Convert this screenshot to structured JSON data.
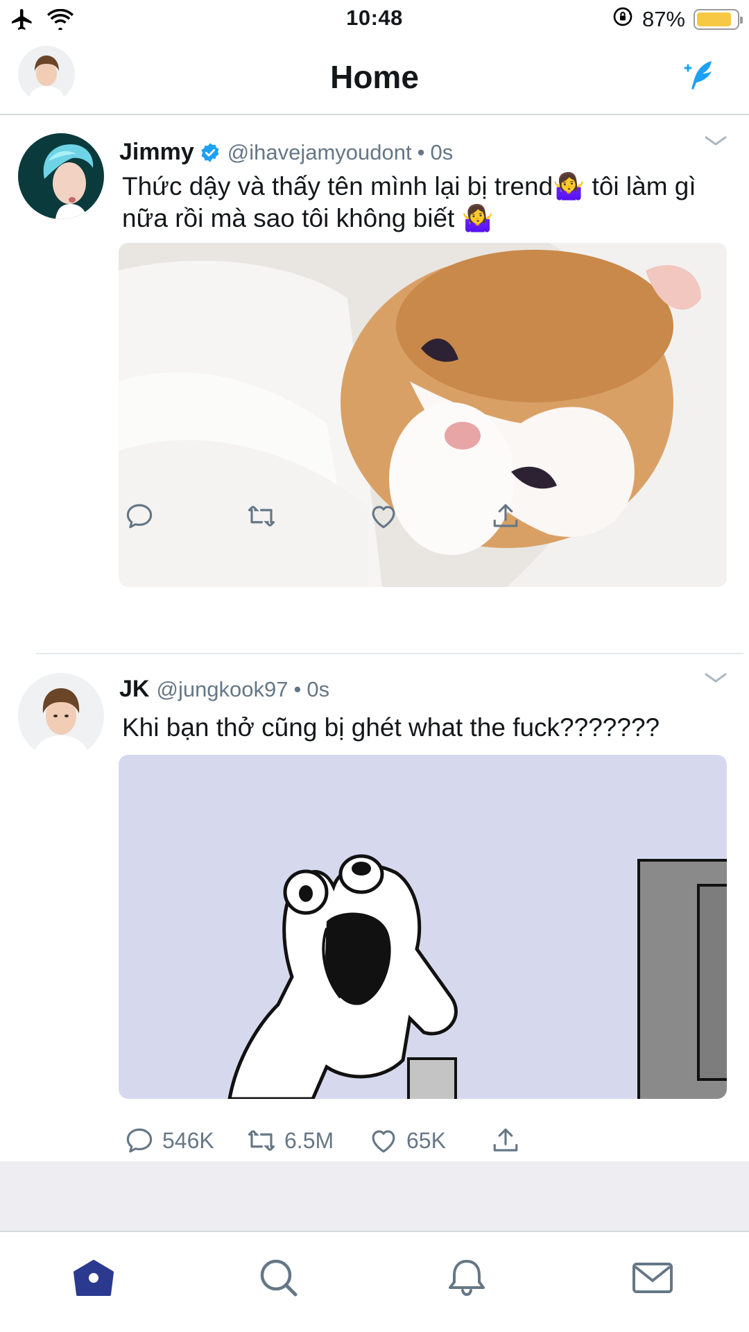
{
  "status_bar": {
    "time": "10:48",
    "battery_percent": "87%",
    "battery_level": 0.87,
    "icons": [
      "airplane-icon",
      "wifi-icon",
      "rotation-lock-icon",
      "battery-icon"
    ]
  },
  "header": {
    "title": "Home",
    "compose_icon": "feather-compose-icon"
  },
  "colors": {
    "accent": "#1da1f2",
    "text": "#14171a",
    "secondary": "#657786",
    "divider": "#e1e8ed",
    "battery": "#f7c843",
    "tab_active": "#2b3a8f"
  },
  "tweets": [
    {
      "name": "Jimmy",
      "verified": true,
      "handle": "@ihavejamyoudont",
      "sep": "•",
      "time": "0s",
      "text": "Thức dậy và thấy tên mình lại bị trend🤷‍♀️ tôi làm gì nữa rồi mà sao tôi không biết 🤷‍♀️",
      "media": "kitten-photo",
      "stats": {
        "replies": "",
        "retweets": "",
        "likes": ""
      }
    },
    {
      "name": "JK",
      "verified": false,
      "handle": "@jungkook97",
      "sep": "•",
      "time": "0s",
      "text": "Khi bạn thở cũng bị ghét what the fuck???????",
      "media": "rage-comic-image",
      "stats": {
        "replies": "546K",
        "retweets": "6.5M",
        "likes": "65K"
      }
    }
  ],
  "tab_bar": {
    "items": [
      "home-icon",
      "search-icon",
      "notifications-icon",
      "messages-icon"
    ],
    "active": "home-icon"
  }
}
